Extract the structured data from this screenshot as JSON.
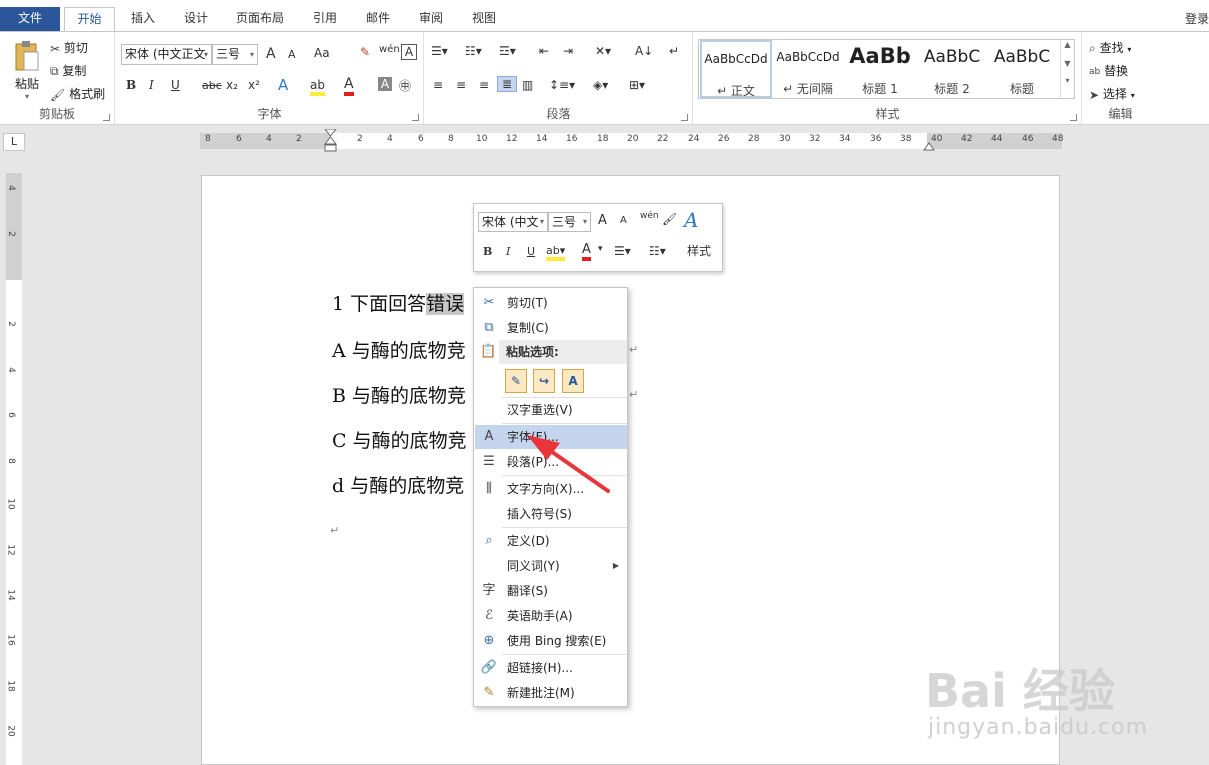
{
  "tabs": [
    "文件",
    "开始",
    "插入",
    "设计",
    "页面布局",
    "引用",
    "邮件",
    "审阅",
    "视图"
  ],
  "login": "登录",
  "clipboard": {
    "paste": "粘贴",
    "cut": "剪切",
    "copy": "复制",
    "format_painter": "格式刷",
    "group": "剪贴板"
  },
  "font": {
    "family": "宋体 (中文正文",
    "size": "三号",
    "group": "字体",
    "grow": "A",
    "shrink": "A",
    "case": "Aa",
    "bold": "B",
    "italic": "I",
    "underline": "U",
    "strike": "abc",
    "sub": "x₂",
    "sup": "x²"
  },
  "paragraph": {
    "group": "段落"
  },
  "styles": {
    "group": "样式",
    "items": [
      {
        "preview": "AaBbCcDd",
        "name": "↵ 正文"
      },
      {
        "preview": "AaBbCcDd",
        "name": "↵ 无间隔"
      },
      {
        "preview": "AaBb",
        "name": "标题 1"
      },
      {
        "preview": "AaBbC",
        "name": "标题 2"
      },
      {
        "preview": "AaBbC",
        "name": "标题"
      }
    ]
  },
  "editing": {
    "find": "查找",
    "replace": "替换",
    "select": "选择",
    "group": "编辑"
  },
  "ruler": {
    "corner": "L",
    "h_ticks": [
      "8",
      "6",
      "4",
      "2",
      "2",
      "4",
      "6",
      "8",
      "10",
      "12",
      "14",
      "16",
      "18",
      "20",
      "22",
      "24",
      "26",
      "28",
      "30",
      "32",
      "34",
      "36",
      "38",
      "40",
      "42",
      "44",
      "46",
      "48"
    ],
    "v_ticks": [
      "4",
      "2",
      "2",
      "4",
      "6",
      "8",
      "10",
      "12",
      "14",
      "16",
      "18",
      "20"
    ]
  },
  "document": {
    "lines": [
      {
        "prefix": "1 下面回答",
        "highlight": "错误"
      },
      {
        "prefix": "A 与酶的底物竞",
        "highlight": ""
      },
      {
        "prefix": "B 与酶的底物竞",
        "highlight": ""
      },
      {
        "prefix": "C 与酶的底物竞",
        "highlight": ""
      },
      {
        "prefix": "d 与酶的底物竞",
        "highlight": ""
      }
    ],
    "para_mark": "↵"
  },
  "mini_toolbar": {
    "font": "宋体 (中文",
    "size": "三号",
    "styles": "样式"
  },
  "context_menu": {
    "cut": "剪切(T)",
    "copy": "复制(C)",
    "paste_options": "粘贴选项:",
    "reconvert": "汉字重选(V)",
    "font": "字体(F)...",
    "paragraph": "段落(P)...",
    "text_direction": "文字方向(X)...",
    "insert_symbol": "插入符号(S)",
    "define": "定义(D)",
    "synonyms": "同义词(Y)",
    "translate": "翻译(S)",
    "english_assistant": "英语助手(A)",
    "bing_search": "使用 Bing 搜索(E)",
    "hyperlink": "超链接(H)...",
    "new_comment": "新建批注(M)"
  },
  "watermark": {
    "brand": "Bai 经验",
    "url": "jingyan.baidu.com"
  },
  "colors": {
    "accent": "#2b579a",
    "highlight_menu": "#c5d5ee",
    "arrow": "#e8353a"
  }
}
